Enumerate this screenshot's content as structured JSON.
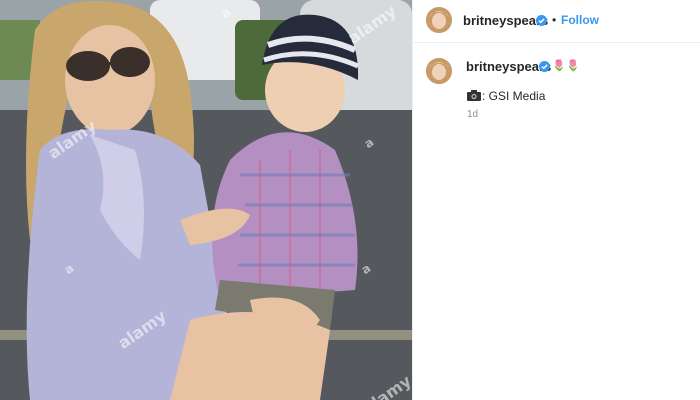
{
  "photo": {
    "watermark": "alamy",
    "watermark_letter": "a"
  },
  "header": {
    "username": "britneyspears",
    "separator": "•",
    "follow_label": "Follow"
  },
  "comment": {
    "username": "britneyspears",
    "emojis": [
      "🌷",
      "🌷"
    ],
    "caption_icon": "camera-icon",
    "caption_text": "GSI Media",
    "time": "1d"
  },
  "colors": {
    "follow": "#3897f0",
    "verified": "#3897f0",
    "text": "#262626",
    "muted": "#8e8e8e"
  }
}
